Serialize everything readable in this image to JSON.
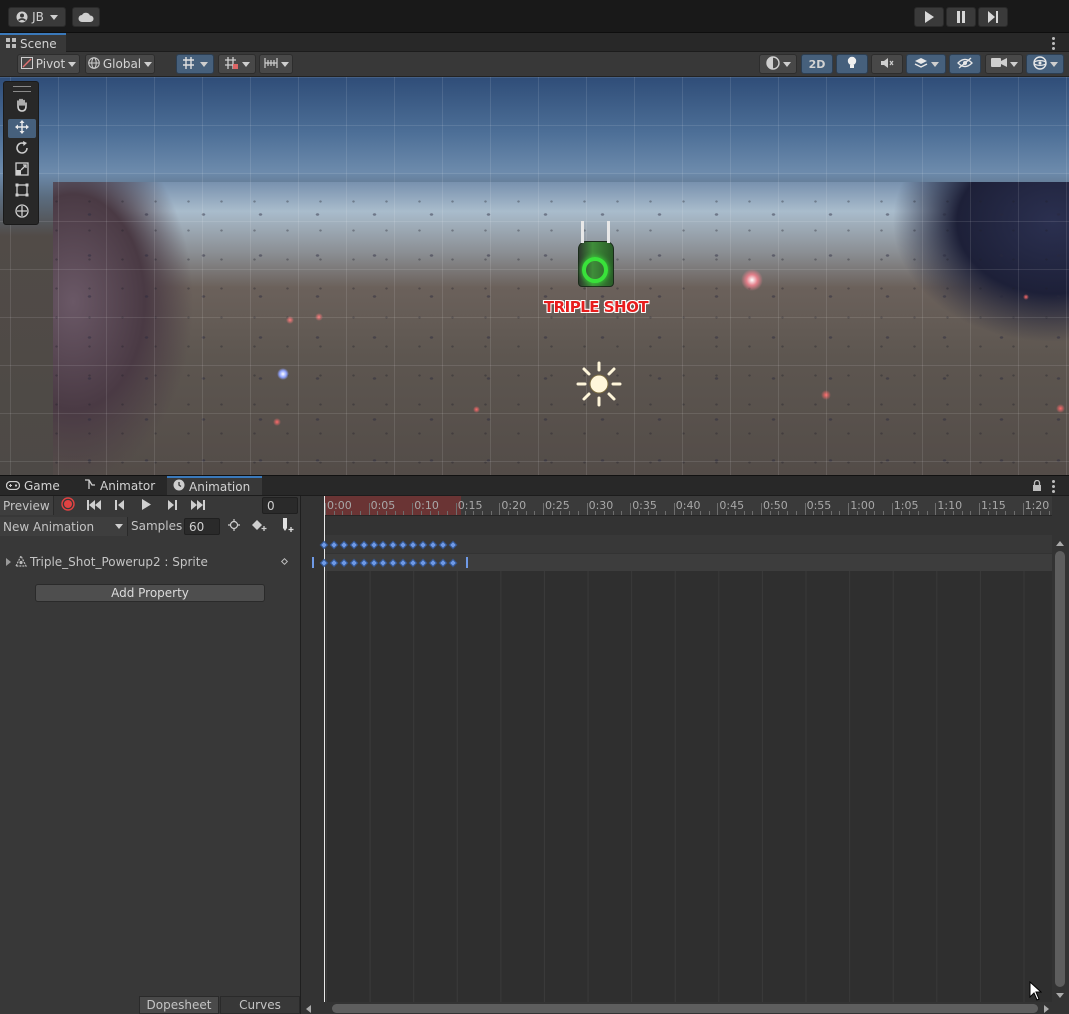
{
  "app": {
    "account_label": "JB",
    "account_icon": "user-icon",
    "cloud_icon": "cloud-icon",
    "play_icon": "play-icon",
    "pause_icon": "pause-icon",
    "step_icon": "step-icon"
  },
  "scene": {
    "tab_label": "Scene",
    "toolbar": {
      "pivot_label": "Pivot",
      "global_label": "Global",
      "mode_2d_label": "2D"
    },
    "tools": [
      "hand-tool-icon",
      "move-tool-icon",
      "rotate-tool-icon",
      "scale-tool-icon",
      "rect-tool-icon",
      "transform-tool-icon"
    ],
    "powerup_text": "TRIPLE SHOT"
  },
  "bottom_tabs": [
    {
      "label": "Game",
      "icon": "gamepad-icon"
    },
    {
      "label": "Animator",
      "icon": "animator-icon"
    },
    {
      "label": "Animation",
      "icon": "clock-icon"
    }
  ],
  "animation": {
    "preview_label": "Preview",
    "frame_value": "0",
    "clip_name": "New Animation",
    "samples_label": "Samples",
    "samples_value": "60",
    "property_label": "Triple_Shot_Powerup2 : Sprite",
    "add_property_label": "Add Property",
    "dopesheet_label": "Dopesheet",
    "curves_label": "Curves",
    "time_labels": [
      "0:00",
      "0:05",
      "0:10",
      "0:15",
      "0:20",
      "0:25",
      "0:30",
      "0:35",
      "0:40",
      "0:45",
      "0:50",
      "0:55",
      "1:00",
      "1:05",
      "1:10",
      "1:15",
      "1:20"
    ],
    "keyframe_count": 14,
    "colors": {
      "record": "#e24242",
      "keyframe": "#6f9ae6",
      "selection": "#7a3b3b",
      "accent": "#3a79bb"
    }
  }
}
